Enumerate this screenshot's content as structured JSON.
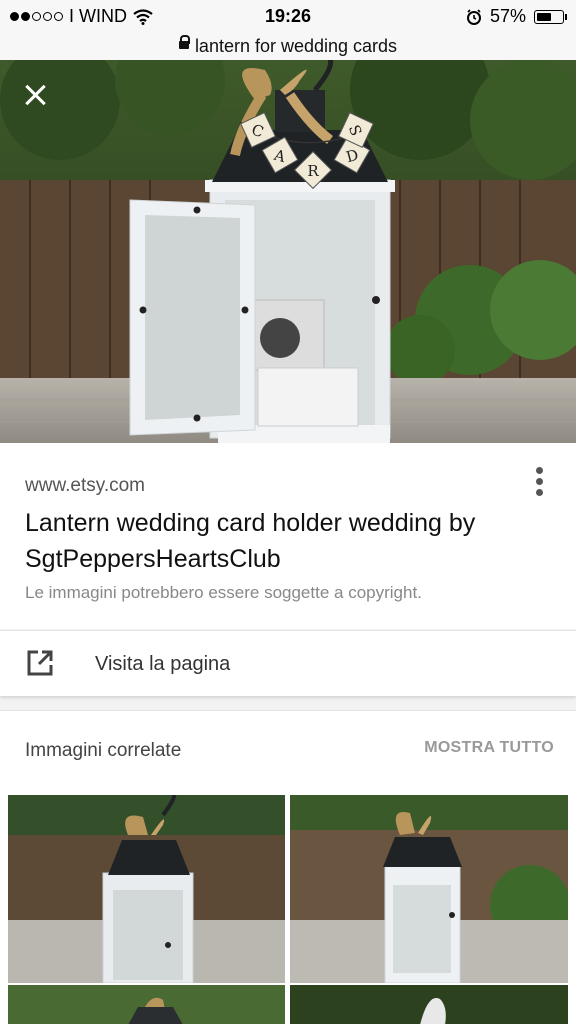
{
  "status": {
    "carrier": "I WIND",
    "time": "19:26",
    "battery": "57%",
    "battery_level": 0.57,
    "signal_icon": "signal-dots-icon",
    "wifi_icon": "wifi-icon",
    "alarm_icon": "alarm-icon"
  },
  "urlbar": {
    "url": "lantern for wedding cards",
    "lock_icon": "lock-icon"
  },
  "hero": {
    "close_icon": "close-icon",
    "banner_letters": [
      "C",
      "A",
      "R",
      "D",
      "S"
    ]
  },
  "result": {
    "site": "www.etsy.com",
    "title": "Lantern wedding card holder wedding by SgtPeppersHeartsClub",
    "copyright": "Le immagini potrebbero essere soggette a copyright.",
    "menu_icon": "more-vert-icon"
  },
  "visit": {
    "label": "Visita la pagina",
    "icon": "open-in-new-icon"
  },
  "related": {
    "title": "Immagini correlate",
    "show_all": "MOSTRA TUTTO"
  },
  "colors": {
    "accent_gray": "#999999",
    "bg": "#f2f2f2"
  }
}
